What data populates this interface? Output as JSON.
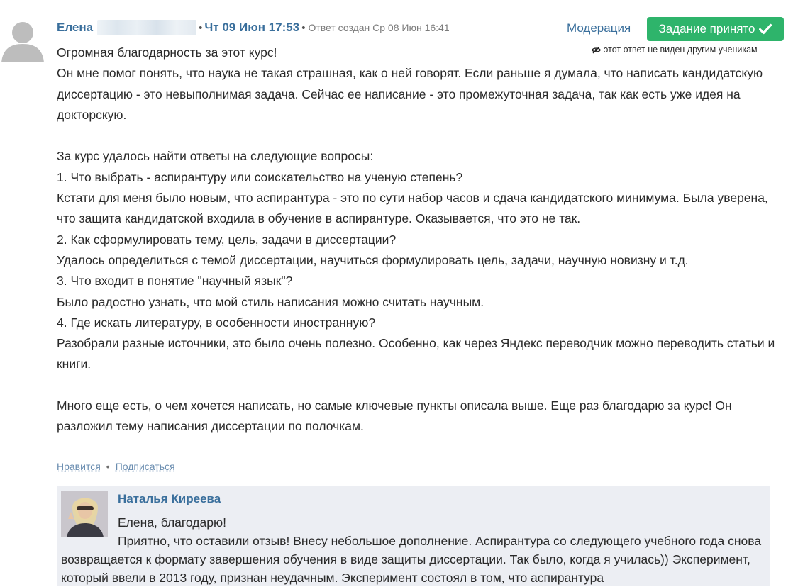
{
  "answer": {
    "author_first_name": "Елена",
    "edited_date": "Чт 09 Июн 17:53",
    "created_label": "Ответ создан Ср 08 Июн 16:41",
    "moderation_label": "Модерация",
    "accepted_label": "Задание принято",
    "hidden_note": "этот ответ не виден другим ученикам",
    "paragraphs": [
      "Огромная благодарность за этот курс!",
      "Он мне помог понять, что наука не такая страшная, как о ней говорят. Если раньше я думала, что написать кандидатскую диссертацию - это невыполнимая задача. Сейчас ее написание - это промежуточная задача, так как есть уже идея на докторскую.",
      "",
      "За курс удалось найти ответы на следующие вопросы:",
      "1. Что выбрать - аспирантуру или соискательство на ученую степень?",
      "Кстати для меня было новым, что аспирантура - это по сути набор часов и сдача кандидатского минимума. Была уверена, что защита кандидатской входила в обучение в аспирантуре. Оказывается, что это не так.",
      "2. Как сформулировать тему, цель, задачи в диссертации?",
      "Удалось определиться с темой диссертации, научиться формулировать цель, задачи, научную новизну и т.д.",
      "3. Что входит в понятие \"научный язык\"?",
      "Было радостно узнать, что мой стиль написания можно считать научным.",
      "4. Где искать литературу, в особенности иностранную?",
      "Разобрали разные источники, это было очень полезно. Особенно, как через Яндекс переводчик можно переводить статьи и книги.",
      "",
      "Много еще есть, о чем хочется написать, но самые ключевые пункты описала выше. Еще раз благодарю за курс! Он разложил тему написания диссертации по полочкам."
    ]
  },
  "actions": {
    "like_label": "Нравится",
    "subscribe_label": "Подписаться"
  },
  "reply": {
    "author": "Наталья Киреева",
    "greeting": "Елена, благодарю!",
    "text": "Приятно, что оставили отзыв! Внесу небольшое дополнение. Аспирантура со следующего учебного года снова возвращается к формату завершения обучения в виде защиты диссертации. Так было, когда я училась)) Эксперимент, который ввели в 2013 году, признан неудачным. Эксперимент состоял в том, что аспирантура"
  },
  "colors": {
    "link": "#3a6f9c",
    "accepted_button": "#2eb46b",
    "reply_background": "#eceef3"
  }
}
